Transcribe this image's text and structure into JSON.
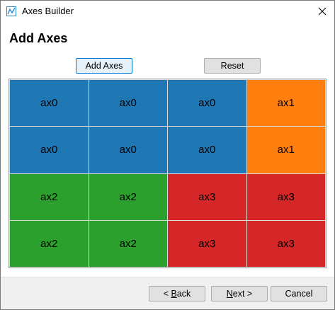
{
  "window": {
    "title": "Axes Builder",
    "close_icon": "close-icon",
    "app_icon": "chart-icon"
  },
  "heading": "Add Axes",
  "toolbar": {
    "add_label": "Add Axes",
    "reset_label": "Reset"
  },
  "colors": {
    "ax0": "#1f77b4",
    "ax1": "#ff7f0e",
    "ax2": "#2ca02c",
    "ax3": "#d62728"
  },
  "grid": {
    "rows": [
      [
        "ax0",
        "ax0",
        "ax0",
        "ax1"
      ],
      [
        "ax0",
        "ax0",
        "ax0",
        "ax1"
      ],
      [
        "ax2",
        "ax2",
        "ax3",
        "ax3"
      ],
      [
        "ax2",
        "ax2",
        "ax3",
        "ax3"
      ]
    ]
  },
  "footer": {
    "back": {
      "prefix": "< ",
      "mnemonic": "B",
      "rest": "ack"
    },
    "next": {
      "mnemonic": "N",
      "rest": "ext >"
    },
    "cancel": "Cancel"
  }
}
